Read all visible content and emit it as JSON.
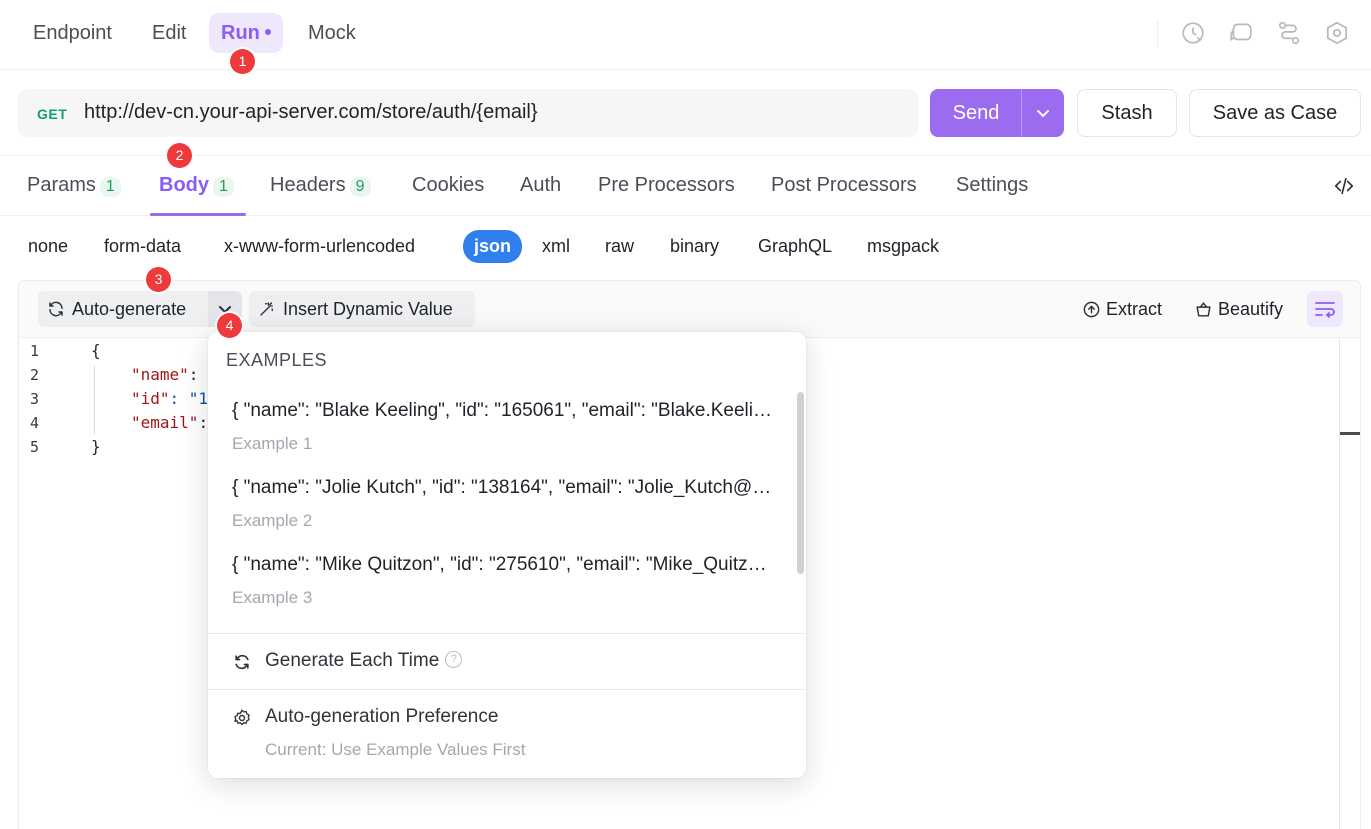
{
  "top_tabs": [
    {
      "label": "Endpoint"
    },
    {
      "label": "Edit"
    },
    {
      "label": "Run"
    },
    {
      "label": "Mock"
    }
  ],
  "top_icons": [
    "history-icon",
    "chat-icon",
    "flow-icon",
    "settings-hex-icon"
  ],
  "request": {
    "method": "GET",
    "url": "http://dev-cn.your-api-server.com/store/auth/{email}",
    "send_label": "Send",
    "stash_label": "Stash",
    "save_case_label": "Save as Case"
  },
  "request_tabs": [
    {
      "label": "Params",
      "count": "1"
    },
    {
      "label": "Body",
      "count": "1"
    },
    {
      "label": "Headers",
      "count": "9"
    },
    {
      "label": "Cookies"
    },
    {
      "label": "Auth"
    },
    {
      "label": "Pre Processors"
    },
    {
      "label": "Post Processors"
    },
    {
      "label": "Settings"
    }
  ],
  "body_types": [
    "none",
    "form-data",
    "x-www-form-urlencoded",
    "json",
    "xml",
    "raw",
    "binary",
    "GraphQL",
    "msgpack"
  ],
  "body_type_selected": "json",
  "toolbar": {
    "auto_generate": "Auto-generate",
    "insert_dynamic": "Insert Dynamic Value",
    "extract": "Extract",
    "beautify": "Beautify"
  },
  "editor": {
    "line_numbers": [
      "1",
      "2",
      "3",
      "4",
      "5"
    ],
    "lines": {
      "l1": "{",
      "l2_key": "\"name\"",
      "l2_rest": ":",
      "l3_key": "\"id\"",
      "l3_rest": ": \"1",
      "l4_key": "\"email\"",
      "l4_rest": ":",
      "l5": "}"
    }
  },
  "dropdown": {
    "header": "EXAMPLES",
    "examples": [
      {
        "value": "{ \"name\": \"Blake Keeling\", \"id\": \"165061\", \"email\": \"Blake.Keeling@example.com\" }",
        "label": "Example 1"
      },
      {
        "value": "{ \"name\": \"Jolie Kutch\", \"id\": \"138164\", \"email\": \"Jolie_Kutch@example.com\" }",
        "label": "Example 2"
      },
      {
        "value": "{ \"name\": \"Mike Quitzon\", \"id\": \"275610\", \"email\": \"Mike_Quitzon@example.com\" }",
        "label": "Example 3"
      }
    ],
    "generate_each_time": "Generate Each Time",
    "preference_label": "Auto-generation Preference",
    "preference_current": "Current: Use Example Values First"
  },
  "step_markers": [
    "1",
    "2",
    "3",
    "4"
  ],
  "colors": {
    "accent": "#8b5cf6",
    "send_button": "#9b6cf0",
    "method_get": "#13a06d",
    "json_pill": "#2f80ed",
    "marker": "#ee3a3a"
  }
}
